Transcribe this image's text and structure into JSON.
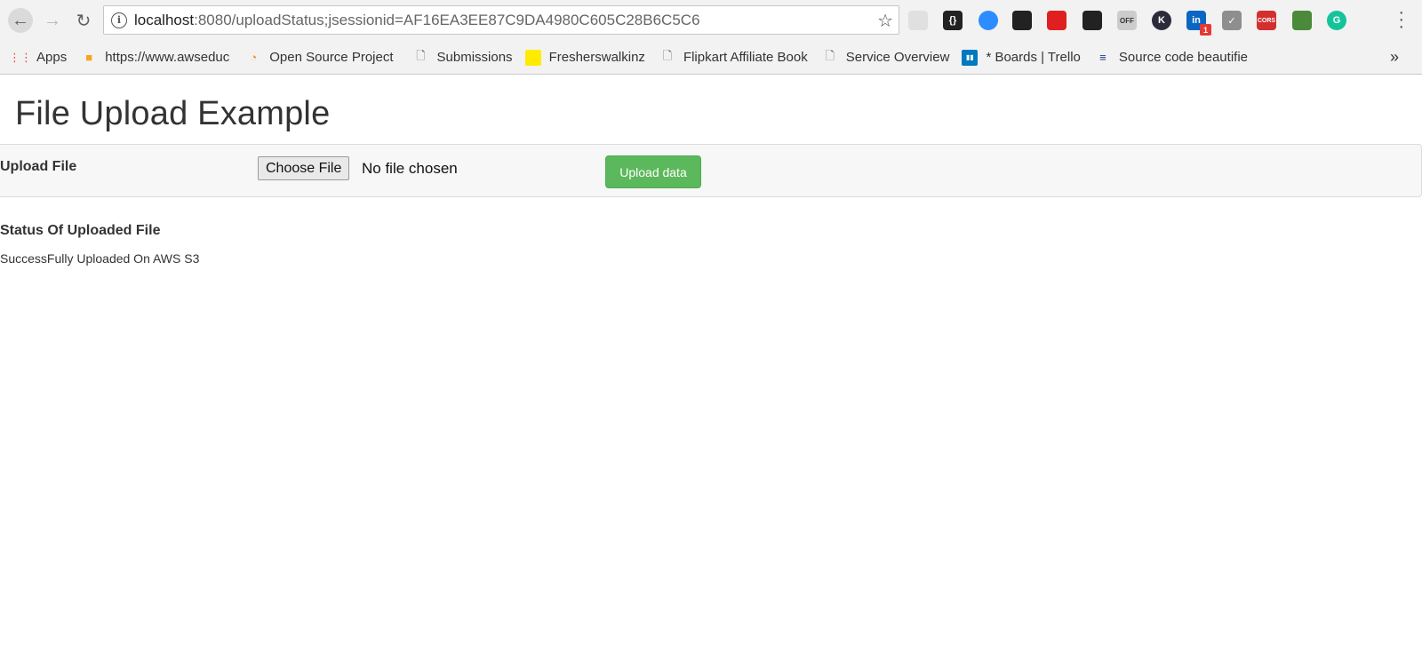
{
  "browser": {
    "url_host": "localhost",
    "url_rest": ":8080/uploadStatus;jsessionid=AF16EA3EE87C9DA4980C605C28B6C5C6",
    "extension_badge": "1",
    "extensions": [
      {
        "name": "pocket-icon",
        "color": "#e0e0e0",
        "label": ""
      },
      {
        "name": "json-viewer-icon",
        "color": "#222222",
        "label": "{}"
      },
      {
        "name": "zoom-icon",
        "color": "#2d8cff",
        "label": ""
      },
      {
        "name": "buffer-icon",
        "color": "#222222",
        "label": ""
      },
      {
        "name": "opera-icon",
        "color": "#e02020",
        "label": ""
      },
      {
        "name": "link-icon",
        "color": "#222222",
        "label": ""
      },
      {
        "name": "off-icon",
        "color": "#cccccc",
        "label": "OFF"
      },
      {
        "name": "k-icon",
        "color": "#2b2b3b",
        "label": "K"
      },
      {
        "name": "linkedin-icon",
        "color": "#0a66c2",
        "label": "in"
      },
      {
        "name": "check-icon",
        "color": "#8e8e8e",
        "label": "✓"
      },
      {
        "name": "cors-icon",
        "color": "#d32f2f",
        "label": "CORS"
      },
      {
        "name": "eyedropper-icon",
        "color": "#4a8a3a",
        "label": ""
      },
      {
        "name": "grammarly-icon",
        "color": "#15c39a",
        "label": "G"
      }
    ]
  },
  "bookmarks": [
    {
      "label": "Apps",
      "icon": "apps-grid-icon"
    },
    {
      "label": "https://www.awseduc",
      "icon": "box-icon"
    },
    {
      "label": "Open Source Project",
      "icon": "flame-icon"
    },
    {
      "label": "Submissions",
      "icon": "page-icon"
    },
    {
      "label": "Fresherswalkinz",
      "icon": "jobs-icon"
    },
    {
      "label": "Flipkart Affiliate Book",
      "icon": "page-icon"
    },
    {
      "label": "Service Overview",
      "icon": "page-icon"
    },
    {
      "label": "* Boards | Trello",
      "icon": "trello-icon"
    },
    {
      "label": "Source code beautifie",
      "icon": "lines-icon"
    }
  ],
  "bookmarks_more": "»",
  "page": {
    "title": "File Upload Example",
    "upload_label": "Upload File",
    "choose_file": "Choose File",
    "no_file": "No file chosen",
    "upload_button": "Upload data",
    "status_heading": "Status Of Uploaded File",
    "status_text": "SuccessFully Uploaded On AWS S3"
  },
  "colors": {
    "success_button": "#5cb85c"
  }
}
